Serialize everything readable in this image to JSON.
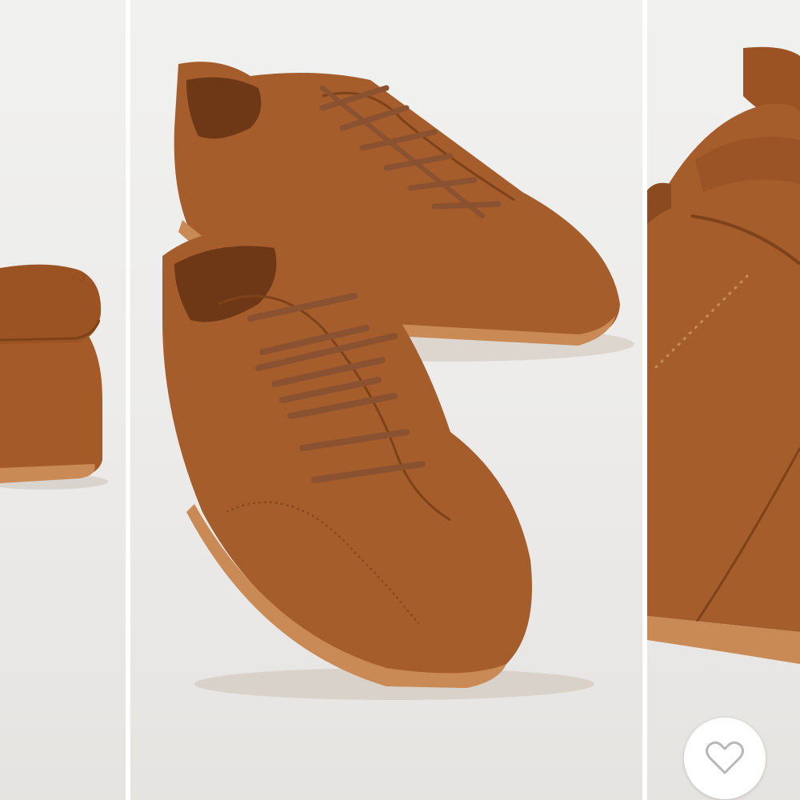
{
  "gallery": {
    "images": [
      {
        "name": "product-image-back-view"
      },
      {
        "name": "product-image-pair-main"
      },
      {
        "name": "product-image-detail-closeup"
      }
    ]
  },
  "wishlist": {
    "icon": "heart-outline-icon",
    "selected": false
  },
  "colors": {
    "suede": "#a55d2b",
    "suede_dark": "#7e4219",
    "sole": "#c98a55",
    "lace": "#8a5230",
    "heart_stroke": "#b8b8b8"
  }
}
